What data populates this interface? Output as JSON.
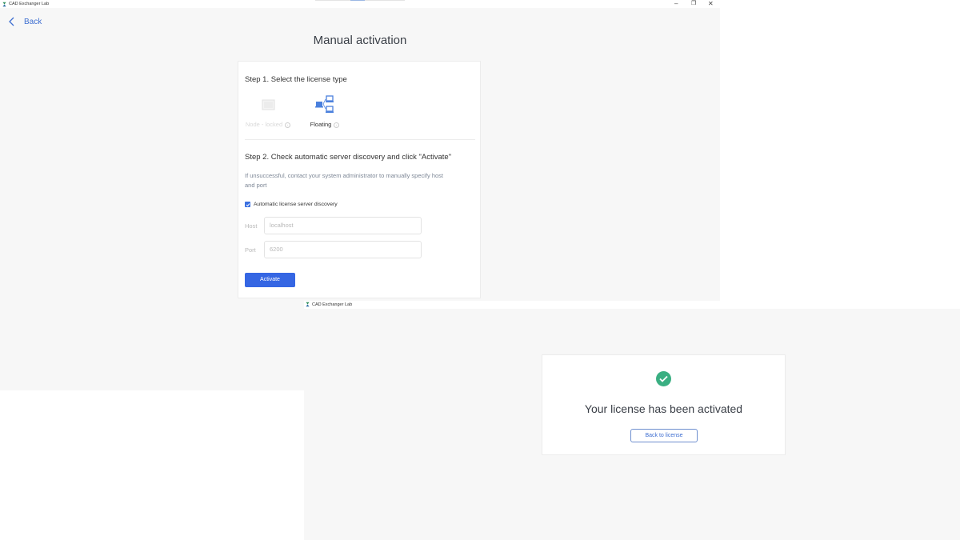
{
  "window1": {
    "app_title": "CAD Exchanger Lab",
    "controls": {
      "minimize": "–",
      "restore": "❐",
      "close": "✕"
    },
    "back_label": "Back",
    "page_title": "Manual activation",
    "step1": {
      "title": "Step 1. Select the license type",
      "options": [
        {
          "label": "Node - locked",
          "icon": "laptop-icon",
          "state": "disabled"
        },
        {
          "label": "Floating",
          "icon": "network-computers-icon",
          "state": "selected"
        }
      ]
    },
    "step2": {
      "title": "Step 2. Check automatic server discovery and click \"Activate\"",
      "hint": "If unsuccessful, contact your system administrator to manually specify host and port",
      "checkbox_label": "Automatic license server discovery",
      "checkbox_checked": true,
      "host_label": "Host",
      "host_value": "localhost",
      "port_label": "Port",
      "port_value": "6200",
      "activate_label": "Activate"
    }
  },
  "window2": {
    "app_title": "CAD Exchanger Lab",
    "success_title": "Your license has been activated",
    "back_to_license_label": "Back to license"
  },
  "colors": {
    "accent": "#3566e3",
    "success": "#3aaf82",
    "background": "#f7f7f7"
  }
}
